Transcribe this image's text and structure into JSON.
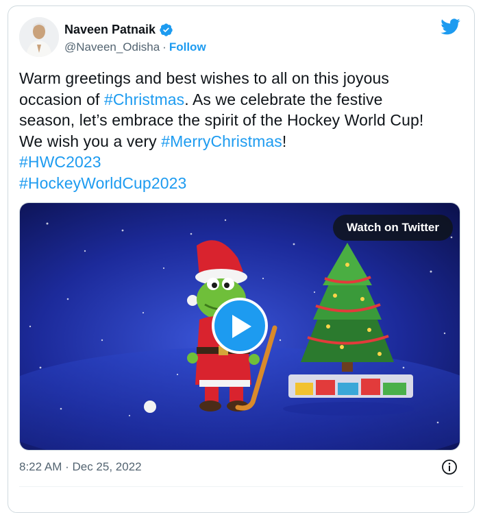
{
  "author": {
    "name": "Naveen Patnaik",
    "handle": "@Naveen_Odisha",
    "separator": "·",
    "follow_label": "Follow"
  },
  "tweet": {
    "lines": [
      [
        {
          "text": "Warm greetings and best wishes to all on this joyous"
        }
      ],
      [
        {
          "text": "occasion of "
        },
        {
          "text": "#Christmas",
          "tag": true
        },
        {
          "text": ". As we celebrate the festive"
        }
      ],
      [
        {
          "text": "season, let’s embrace the spirit of the Hockey World Cup!"
        }
      ],
      [
        {
          "text": "We wish you a very "
        },
        {
          "text": "#MerryChristmas",
          "tag": true
        },
        {
          "text": "!"
        }
      ],
      [
        {
          "text": "#HWC2023",
          "tag": true
        }
      ],
      [
        {
          "text": "#HockeyWorldCup2023",
          "tag": true
        }
      ]
    ]
  },
  "media": {
    "watch_label": "Watch on Twitter"
  },
  "footer": {
    "timestamp": "8:22 AM · Dec 25, 2022"
  },
  "icons": {
    "brand": "twitter-bird-icon",
    "verified": "verified-badge-icon",
    "play": "play-icon",
    "info": "info-icon"
  },
  "colors": {
    "accent": "#1d9bf0",
    "text": "#0f1419",
    "muted": "#536471"
  }
}
